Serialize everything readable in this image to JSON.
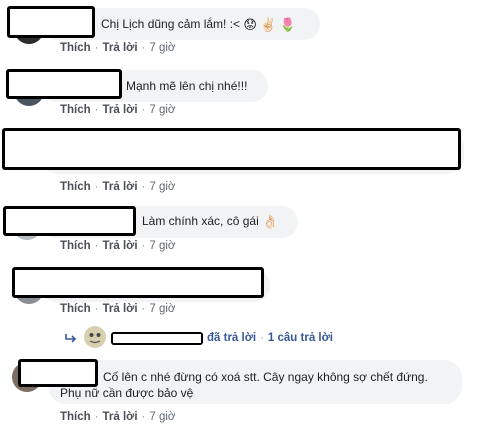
{
  "actions": {
    "like": "Thích",
    "reply": "Trả lời",
    "sep": "·"
  },
  "comments": [
    {
      "text": "Chị Lịch dũng cảm lắm! :<",
      "emojis": [
        "😟",
        "✌🏻",
        "🌷"
      ],
      "time": "7 giờ"
    },
    {
      "text": "Mạnh mẽ lên chị nhé!!!",
      "time": "7 giờ"
    },
    {
      "text": "",
      "time": "7 giờ"
    },
    {
      "text": "Làm chính xác, cô gái",
      "emojis": [
        "👌🏻"
      ],
      "time": "7 giờ"
    },
    {
      "text": "",
      "time": "7 giờ"
    },
    {
      "line1": "Cố lên c nhé đừng có xoá stt. Cây ngay không sợ chết đứng.",
      "line2": "Phụ nữ cần được bảo vệ",
      "time": "7 giờ"
    }
  ],
  "reply_summary": {
    "replied_label": "đã trả lời",
    "count_label": "1 câu trả lời"
  }
}
